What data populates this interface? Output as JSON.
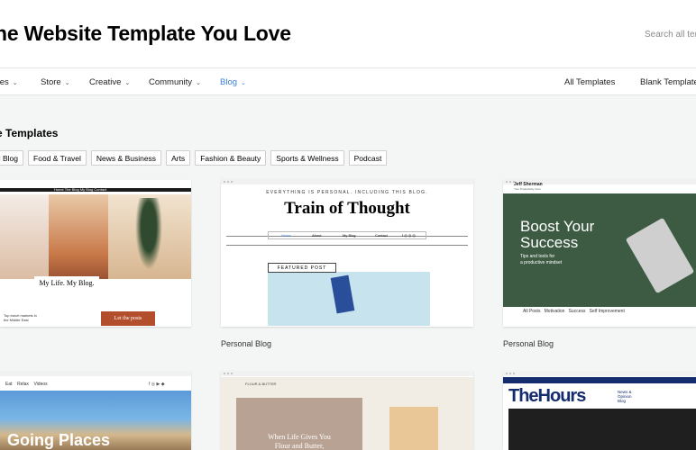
{
  "header": {
    "title": "he Website Template You Love",
    "search_placeholder": "Search all tem"
  },
  "nav": {
    "items": [
      {
        "label": "ces",
        "active": false
      },
      {
        "label": "Store",
        "active": false
      },
      {
        "label": "Creative",
        "active": false
      },
      {
        "label": "Community",
        "active": false
      },
      {
        "label": "Blog",
        "active": true
      }
    ],
    "right": [
      "All Templates",
      "Blank Template"
    ]
  },
  "section": {
    "title": "e Templates",
    "chips": [
      "al Blog",
      "Food & Travel",
      "News & Business",
      "Arts",
      "Fashion & Beauty",
      "Sports & Wellness",
      "Podcast"
    ]
  },
  "cards": [
    {
      "caption": "",
      "preview": {
        "nav": "Home   The Blog   My Blog   Contact",
        "label": "My Life. My Blog.",
        "small": "Top travel markets in the Middle East",
        "button": "Let the posts"
      }
    },
    {
      "caption": "Personal Blog",
      "preview": {
        "small": "EVERYTHING IS PERSONAL. INCLUDING THIS BLOG.",
        "title": "Train of Thought",
        "nav": [
          "Home",
          "About",
          "My Blog",
          "Contact"
        ],
        "featured": "FEATURED POST"
      }
    },
    {
      "caption": "Personal Blog",
      "preview": {
        "name": "Jeff Sherman",
        "sub": "Your Productivity Guru",
        "headline": [
          "Boost Your",
          "Success"
        ],
        "tag": [
          "Tips and tools for",
          "a productive mindset"
        ],
        "footer": [
          "All Posts",
          "Motivation",
          "Success",
          "Self Improvement"
        ]
      }
    },
    {
      "caption": "",
      "preview": {
        "nav": [
          "Eat",
          "Relax",
          "Videos"
        ],
        "title": "Going Places"
      }
    },
    {
      "caption": "",
      "preview": {
        "brand": "FLOUR & BUTTER",
        "text": [
          "When Life Gives You",
          "Flour and Butter,"
        ]
      }
    },
    {
      "caption": "",
      "preview": {
        "brand": "TheHours",
        "tag": [
          "News &",
          "Opinion",
          "Blog"
        ]
      }
    }
  ],
  "colors": {
    "accent": "#3b7fe0",
    "background": "#f4f5f5",
    "green_card": "#3d5b43",
    "navy": "#152c6f",
    "button": "#b34e2c"
  },
  "icons": [
    "chevron-down-icon",
    "facebook-icon",
    "instagram-icon",
    "twitter-icon",
    "pinterest-icon",
    "linkedin-icon"
  ]
}
